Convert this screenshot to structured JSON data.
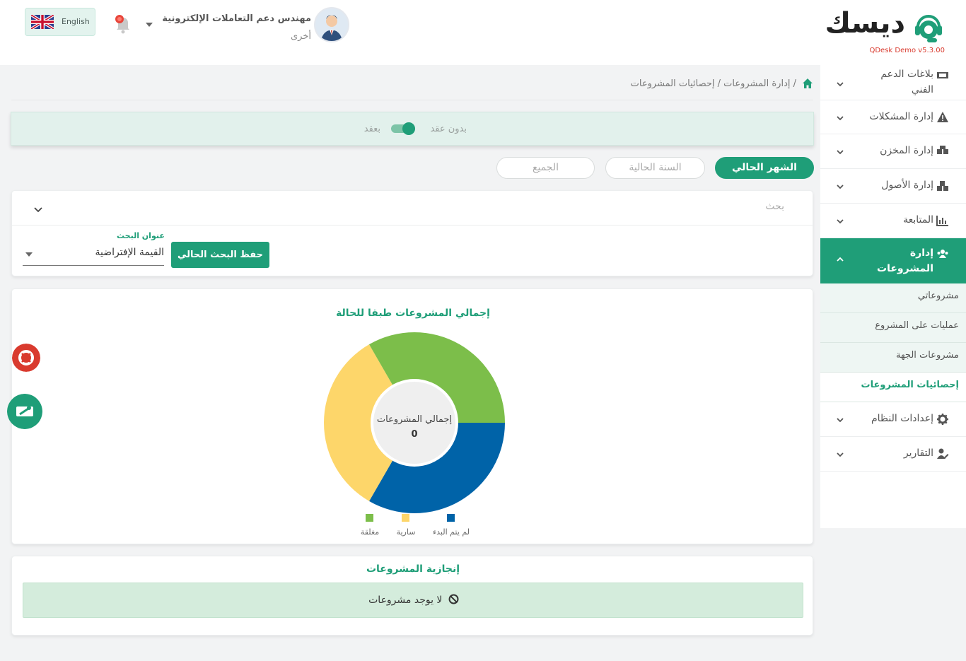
{
  "header": {
    "logo_text": "ديسك",
    "version": "QDesk Demo v5.3.00",
    "user_name": "مهندس دعم التعاملات الإلكترونية",
    "user_role": "أخرى",
    "language_label": "English"
  },
  "sidebar": {
    "items": [
      {
        "label": "بلاغات الدعم الفني",
        "icon": "ticket-icon"
      },
      {
        "label": "إدارة المشكلات",
        "icon": "warning-icon"
      },
      {
        "label": "إدارة المخزن",
        "icon": "boxes-icon"
      },
      {
        "label": "إدارة الأصول",
        "icon": "cubes-icon"
      },
      {
        "label": "المتابعة",
        "icon": "chart-icon"
      },
      {
        "label": "إدارة المشروعات",
        "icon": "users-icon"
      },
      {
        "label": "إعدادات النظام",
        "icon": "gear-icon"
      },
      {
        "label": "التقارير",
        "icon": "user-edit-icon"
      }
    ],
    "sub_items": [
      {
        "label": "مشروعاتي"
      },
      {
        "label": "عمليات على المشروع"
      },
      {
        "label": "مشروعات الجهة"
      },
      {
        "label": "إحصائيات المشروعات"
      }
    ]
  },
  "breadcrumb": {
    "text": "/  إدارة المشروعات  /  إحصائيات المشروعات"
  },
  "contract": {
    "without_label": "بدون عقد",
    "with_label": "بعقد"
  },
  "periods": {
    "current_month": "الشهر الحالي",
    "current_year": "السنة الحالية",
    "all": "الجميع"
  },
  "search": {
    "title": "بحث",
    "field_label": "عنوان البحث",
    "field_value": "القيمة الإفتراضية",
    "save_label": "حفظ البحث الحالي"
  },
  "chart_data": {
    "type": "pie",
    "title": "إجمالي المشروعات طبقا للحالة",
    "center_label": "إجمالي المشروعات",
    "center_value": "0",
    "categories": [
      "لم يتم البدء",
      "سارية",
      "مغلقة"
    ],
    "values": [
      1,
      1,
      1
    ],
    "colors": [
      "#0063a8",
      "#fdd66a",
      "#7cbe4a"
    ],
    "legend_position": "bottom"
  },
  "achievement": {
    "title": "إنجازية المشروعات",
    "empty_text": "لا يوجد مشروعات"
  },
  "colors": {
    "primary": "#1f9e78",
    "danger": "#d93a2e"
  }
}
